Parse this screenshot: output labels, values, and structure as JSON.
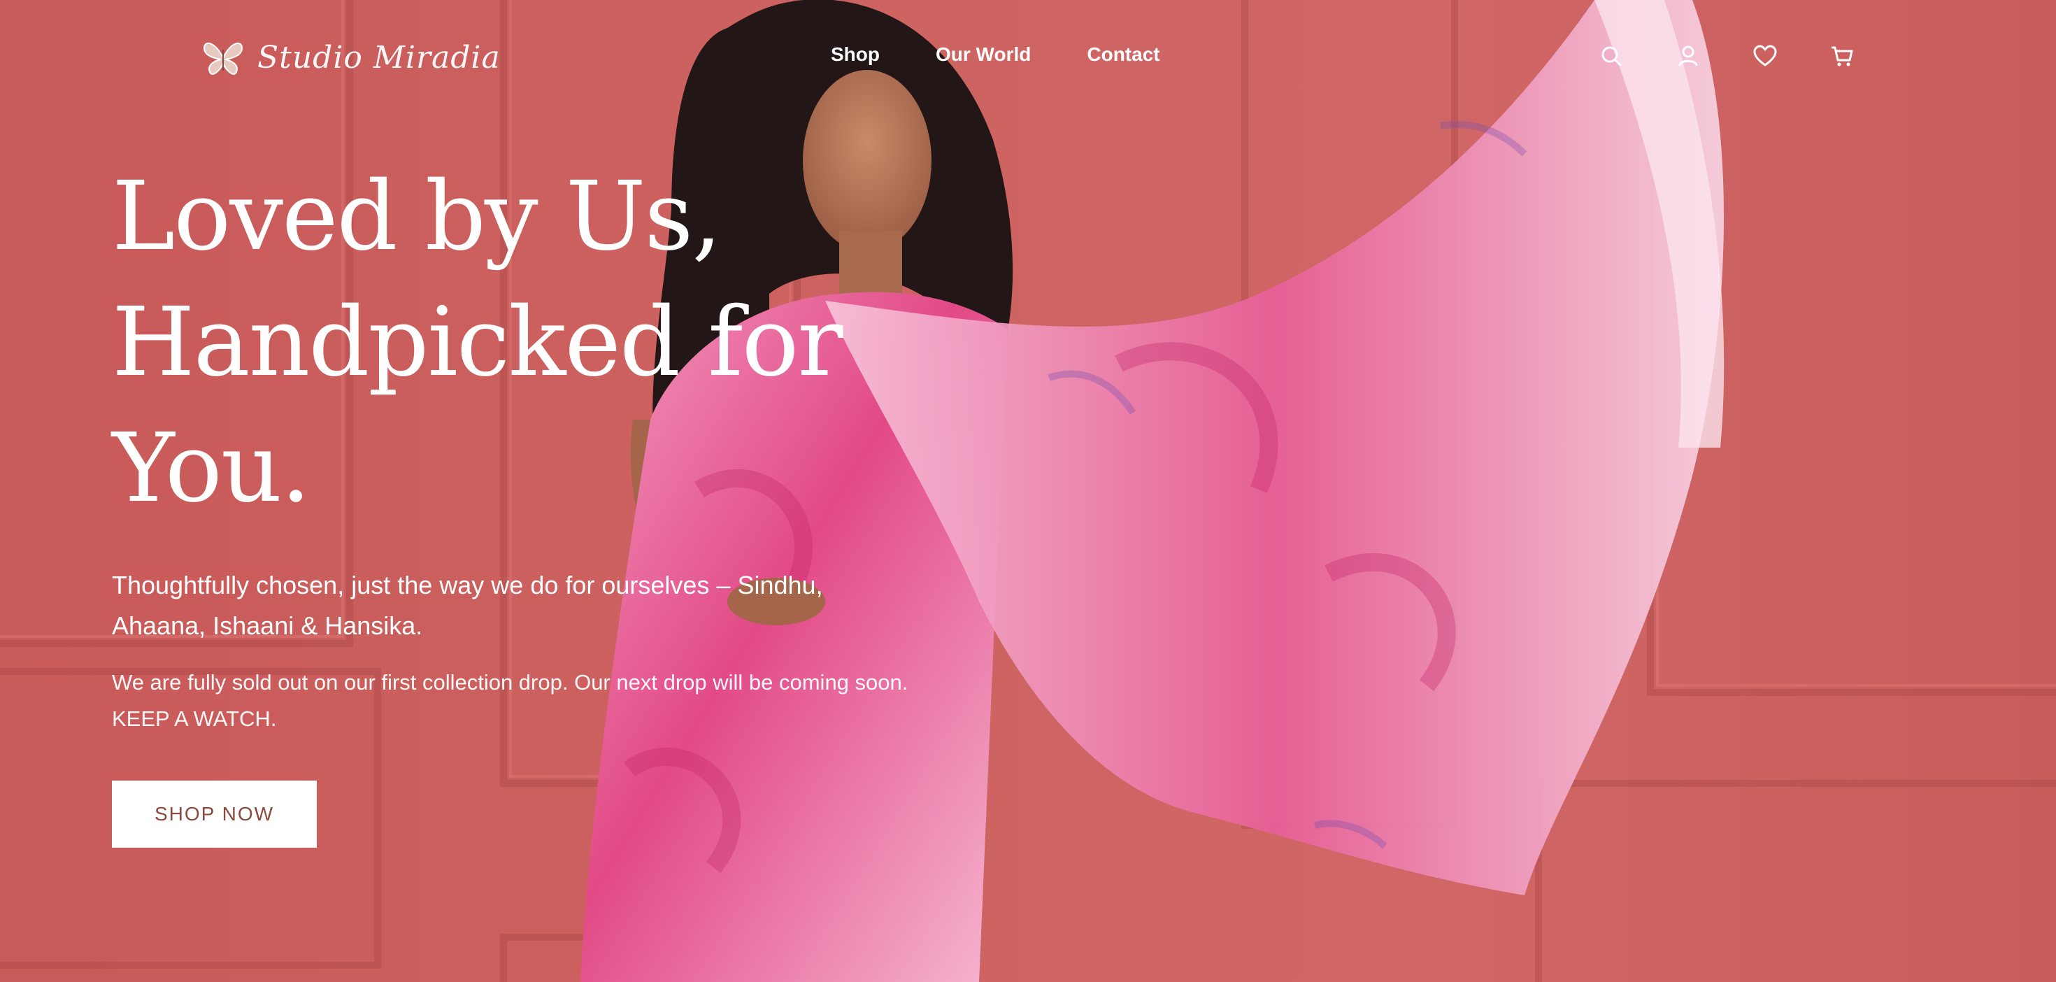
{
  "brand": {
    "logo_text": "Studio Miradia"
  },
  "nav": {
    "items": [
      {
        "label": "Shop"
      },
      {
        "label": "Our World"
      },
      {
        "label": "Contact"
      }
    ],
    "icons": [
      "search-icon",
      "account-icon",
      "wishlist-heart-icon",
      "cart-icon"
    ]
  },
  "hero": {
    "headline_line1": "Loved by Us,",
    "headline_line2": "Handpicked for",
    "headline_line3": "You.",
    "subheading": "Thoughtfully chosen, just the way we do for ourselves – Sindhu, Ahaana, Ishaani & Hansika.",
    "notice": "We are fully sold out on our first collection drop. Our next drop will be coming soon. KEEP A WATCH.",
    "cta_label": "SHOP NOW"
  },
  "colors": {
    "background": "#c95b5a",
    "saree_pink": "#e24a86",
    "button_text": "#8a4b3e"
  }
}
